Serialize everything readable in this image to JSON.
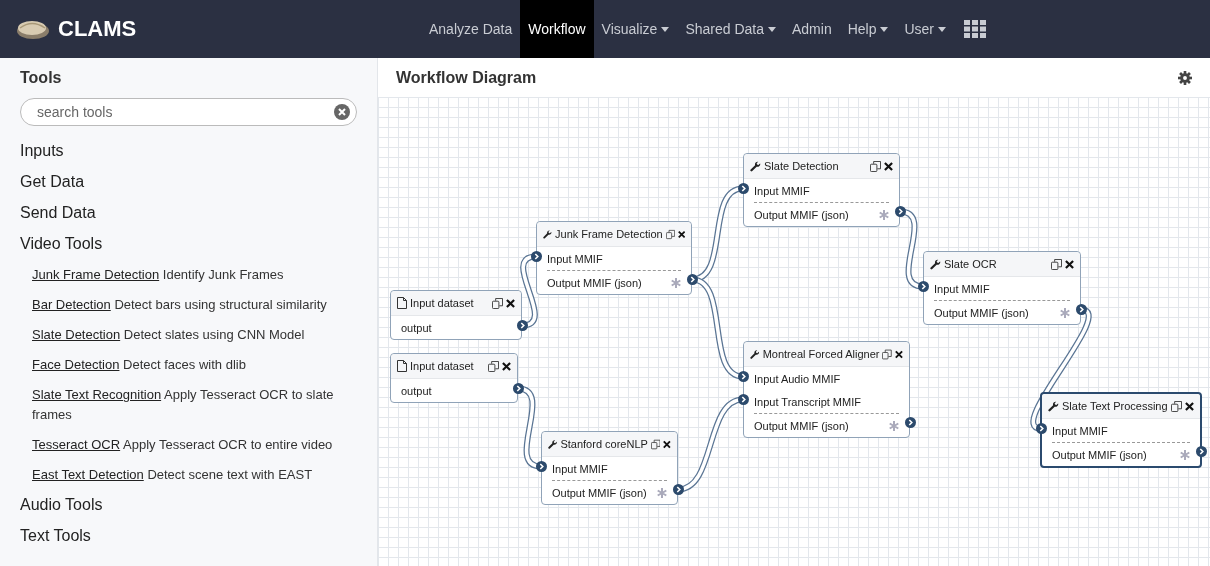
{
  "brand": {
    "name": "CLAMS"
  },
  "nav": [
    {
      "label": "Analyze Data",
      "dropdown": false,
      "selected": false
    },
    {
      "label": "Workflow",
      "dropdown": false,
      "selected": true
    },
    {
      "label": "Visualize",
      "dropdown": true,
      "selected": false
    },
    {
      "label": "Shared Data",
      "dropdown": true,
      "selected": false
    },
    {
      "label": "Admin",
      "dropdown": false,
      "selected": false
    },
    {
      "label": "Help",
      "dropdown": true,
      "selected": false
    },
    {
      "label": "User",
      "dropdown": true,
      "selected": false
    }
  ],
  "sidebar": {
    "title": "Tools",
    "search": {
      "placeholder": "search tools"
    },
    "categories": [
      {
        "label": "Inputs"
      },
      {
        "label": "Get Data"
      },
      {
        "label": "Send Data"
      },
      {
        "label": "Video Tools",
        "tools": [
          {
            "name": "Junk Frame Detection",
            "description": "Identify Junk Frames"
          },
          {
            "name": "Bar Detection",
            "description": "Detect bars using structural similarity"
          },
          {
            "name": "Slate Detection",
            "description": "Detect slates using CNN Model"
          },
          {
            "name": "Face Detection",
            "description": "Detect faces with dlib"
          },
          {
            "name": "Slate Text Recognition",
            "description": "Apply Tesseract OCR to slate frames"
          },
          {
            "name": "Tesseract OCR",
            "description": "Apply Tesseract OCR to entire video"
          },
          {
            "name": "East Text Detection",
            "description": "Detect scene text with EAST"
          }
        ]
      },
      {
        "label": "Audio Tools"
      },
      {
        "label": "Text Tools"
      }
    ]
  },
  "workflow": {
    "title": "Workflow Diagram",
    "nodes": [
      {
        "kind": "input",
        "title": "Input dataset",
        "selected": false,
        "rows": [
          {
            "kind": "output",
            "label": "output"
          }
        ]
      },
      {
        "kind": "input",
        "title": "Input dataset",
        "selected": false,
        "rows": [
          {
            "kind": "output",
            "label": "output"
          }
        ]
      },
      {
        "kind": "tool",
        "title": "Junk Frame Detection",
        "selected": false,
        "rows": [
          {
            "kind": "input",
            "label": "Input MMIF"
          },
          {
            "kind": "output",
            "label": "Output MMIF (json)"
          }
        ]
      },
      {
        "kind": "tool",
        "title": "Stanford coreNLP",
        "selected": false,
        "rows": [
          {
            "kind": "input",
            "label": "Input MMIF"
          },
          {
            "kind": "output",
            "label": "Output MMIF (json)"
          }
        ]
      },
      {
        "kind": "tool",
        "title": "Slate Detection",
        "selected": false,
        "rows": [
          {
            "kind": "input",
            "label": "Input MMIF"
          },
          {
            "kind": "output",
            "label": "Output MMIF (json)"
          }
        ]
      },
      {
        "kind": "tool",
        "title": "Montreal Forced Aligner",
        "selected": false,
        "rows": [
          {
            "kind": "input",
            "label": "Input Audio MMIF"
          },
          {
            "kind": "input",
            "label": "Input Transcript MMIF"
          },
          {
            "kind": "output",
            "label": "Output MMIF (json)"
          }
        ]
      },
      {
        "kind": "tool",
        "title": "Slate OCR",
        "selected": false,
        "rows": [
          {
            "kind": "input",
            "label": "Input MMIF"
          },
          {
            "kind": "output",
            "label": "Output MMIF (json)"
          }
        ]
      },
      {
        "kind": "tool",
        "title": "Slate Text Processing",
        "selected": true,
        "rows": [
          {
            "kind": "input",
            "label": "Input MMIF"
          },
          {
            "kind": "output",
            "label": "Output MMIF (json)"
          }
        ]
      }
    ]
  }
}
